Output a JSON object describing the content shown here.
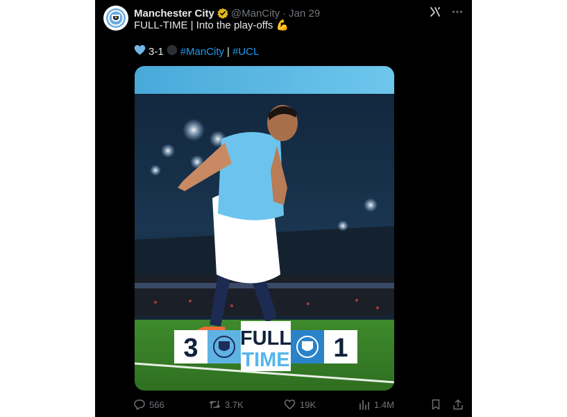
{
  "post": {
    "author": "Manchester City",
    "handle": "@ManCity",
    "date": "Jan 29",
    "line1": "FULL-TIME | Into the play-offs 💪",
    "score": "3-1",
    "hashtag1": "#ManCity",
    "separator": "|",
    "hashtag2": "#UCL"
  },
  "image": {
    "home_score": "3",
    "away_score": "1",
    "full": "FULL",
    "time": "TIME"
  },
  "actions": {
    "replies": "566",
    "reposts": "3.7K",
    "likes": "19K",
    "views": "1.4M"
  },
  "colors": {
    "accent": "#1d9bf0",
    "city_blue": "#6cabdd",
    "background": "#000000"
  }
}
